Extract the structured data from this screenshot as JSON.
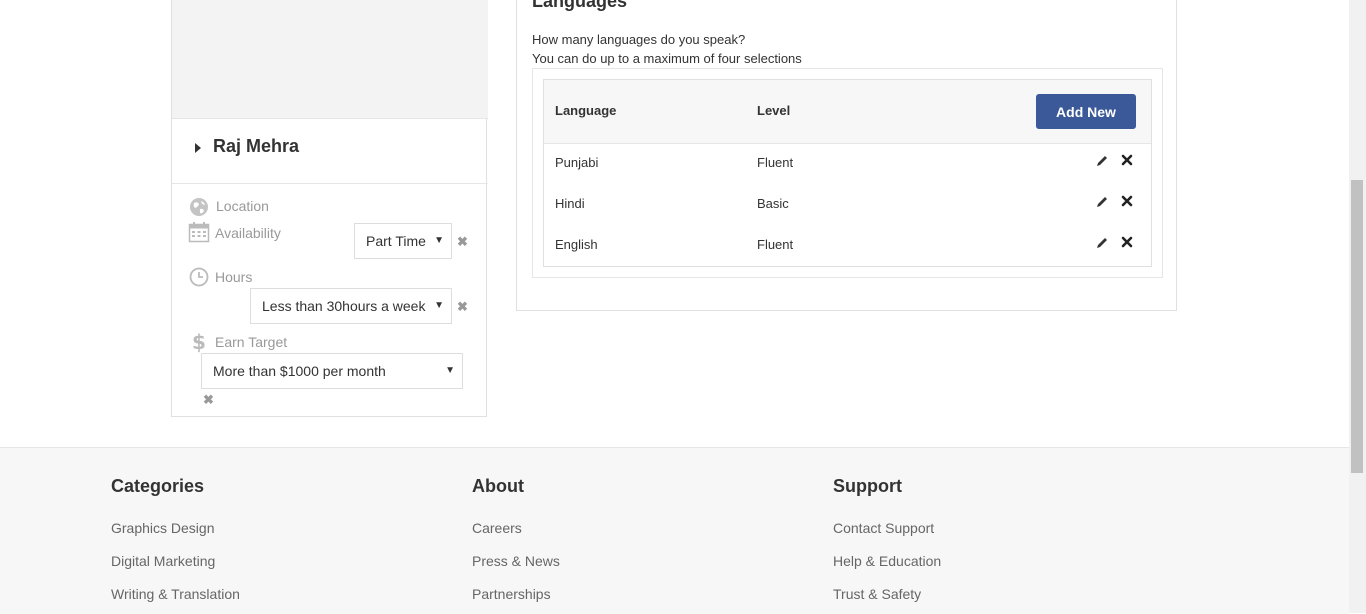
{
  "profile": {
    "name": "Raj Mehra",
    "location_label": "Location",
    "availability_label": "Availability",
    "availability_value": "Part Time",
    "hours_label": "Hours",
    "hours_value": "Less than 30hours a week",
    "earn_label": "Earn Target",
    "earn_value": "More than $1000 per month"
  },
  "languages": {
    "title": "Languages",
    "question": "How many languages do you speak?",
    "note": "You can do up to a maximum of four selections",
    "col_language": "Language",
    "col_level": "Level",
    "add_label": "Add New",
    "rows": [
      {
        "language": "Punjabi",
        "level": "Fluent"
      },
      {
        "language": "Hindi",
        "level": "Basic"
      },
      {
        "language": "English",
        "level": "Fluent"
      }
    ]
  },
  "footer": {
    "categories": {
      "title": "Categories",
      "links": [
        "Graphics Design",
        "Digital Marketing",
        "Writing & Translation"
      ]
    },
    "about": {
      "title": "About",
      "links": [
        "Careers",
        "Press & News",
        "Partnerships"
      ]
    },
    "support": {
      "title": "Support",
      "links": [
        "Contact Support",
        "Help & Education",
        "Trust & Safety"
      ]
    }
  },
  "icons": {
    "location": "globe-icon",
    "availability": "calendar-icon",
    "hours": "clock-icon",
    "earn": "dollar-icon",
    "edit": "pencil-icon",
    "delete": "close-icon"
  },
  "colors": {
    "accent": "#3b5998"
  }
}
